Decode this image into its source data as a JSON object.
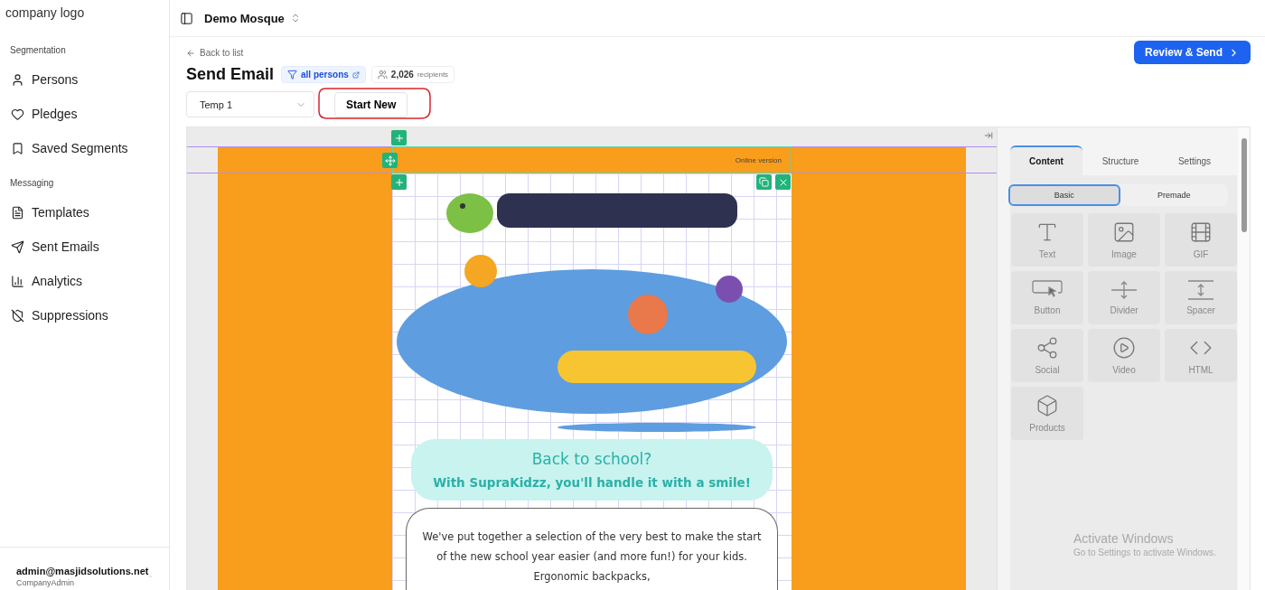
{
  "logo": {
    "alt": "company logo"
  },
  "sidebar": {
    "sections": [
      {
        "title": "Segmentation",
        "items": [
          {
            "label": "Persons",
            "kind": "person"
          },
          {
            "label": "Pledges",
            "kind": "heart"
          },
          {
            "label": "Saved Segments",
            "kind": "bookmark"
          }
        ]
      },
      {
        "title": "Messaging",
        "items": [
          {
            "label": "Templates",
            "kind": "file"
          },
          {
            "label": "Sent Emails",
            "kind": "send"
          },
          {
            "label": "Analytics",
            "kind": "chart"
          },
          {
            "label": "Suppressions",
            "kind": "shield"
          }
        ]
      }
    ],
    "user": {
      "email": "admin@masjidsolutions.net",
      "role": "CompanyAdmin"
    }
  },
  "topbar": {
    "workspace": "Demo Mosque"
  },
  "header": {
    "back_link": "Back to list",
    "title": "Send Email",
    "segment": "all persons",
    "recipients_count": "2,026",
    "recipients_label": "recipients",
    "primary_button": "Review & Send"
  },
  "template_select": {
    "value": "Temp 1"
  },
  "start_new_button": "Start New",
  "editor": {
    "preheader": "Online version",
    "hero_title": "Back to school?",
    "hero_subtitle": "With SupraKidzz, you'll handle it with a smile!",
    "body_text": "We've put together a selection of the very best to make the start of the new school year easier (and more fun!) for your kids. Ergonomic backpacks,"
  },
  "panel": {
    "tabs": [
      {
        "label": "Content",
        "selected": true
      },
      {
        "label": "Structure",
        "selected": false
      },
      {
        "label": "Settings",
        "selected": false
      }
    ],
    "subtabs": [
      {
        "label": "Basic",
        "selected": true
      },
      {
        "label": "Premade",
        "selected": false
      }
    ],
    "blocks": [
      {
        "label": "Text",
        "kind": "text"
      },
      {
        "label": "Image",
        "kind": "image"
      },
      {
        "label": "GIF",
        "kind": "film"
      },
      {
        "label": "Button",
        "kind": "button"
      },
      {
        "label": "Divider",
        "kind": "divider"
      },
      {
        "label": "Spacer",
        "kind": "spacer"
      },
      {
        "label": "Social",
        "kind": "social"
      },
      {
        "label": "Video",
        "kind": "video"
      },
      {
        "label": "HTML",
        "kind": "code"
      },
      {
        "label": "Products",
        "kind": "box"
      }
    ]
  },
  "os_notice": {
    "title": "Activate Windows",
    "subtitle": "Go to Settings to activate Windows."
  }
}
